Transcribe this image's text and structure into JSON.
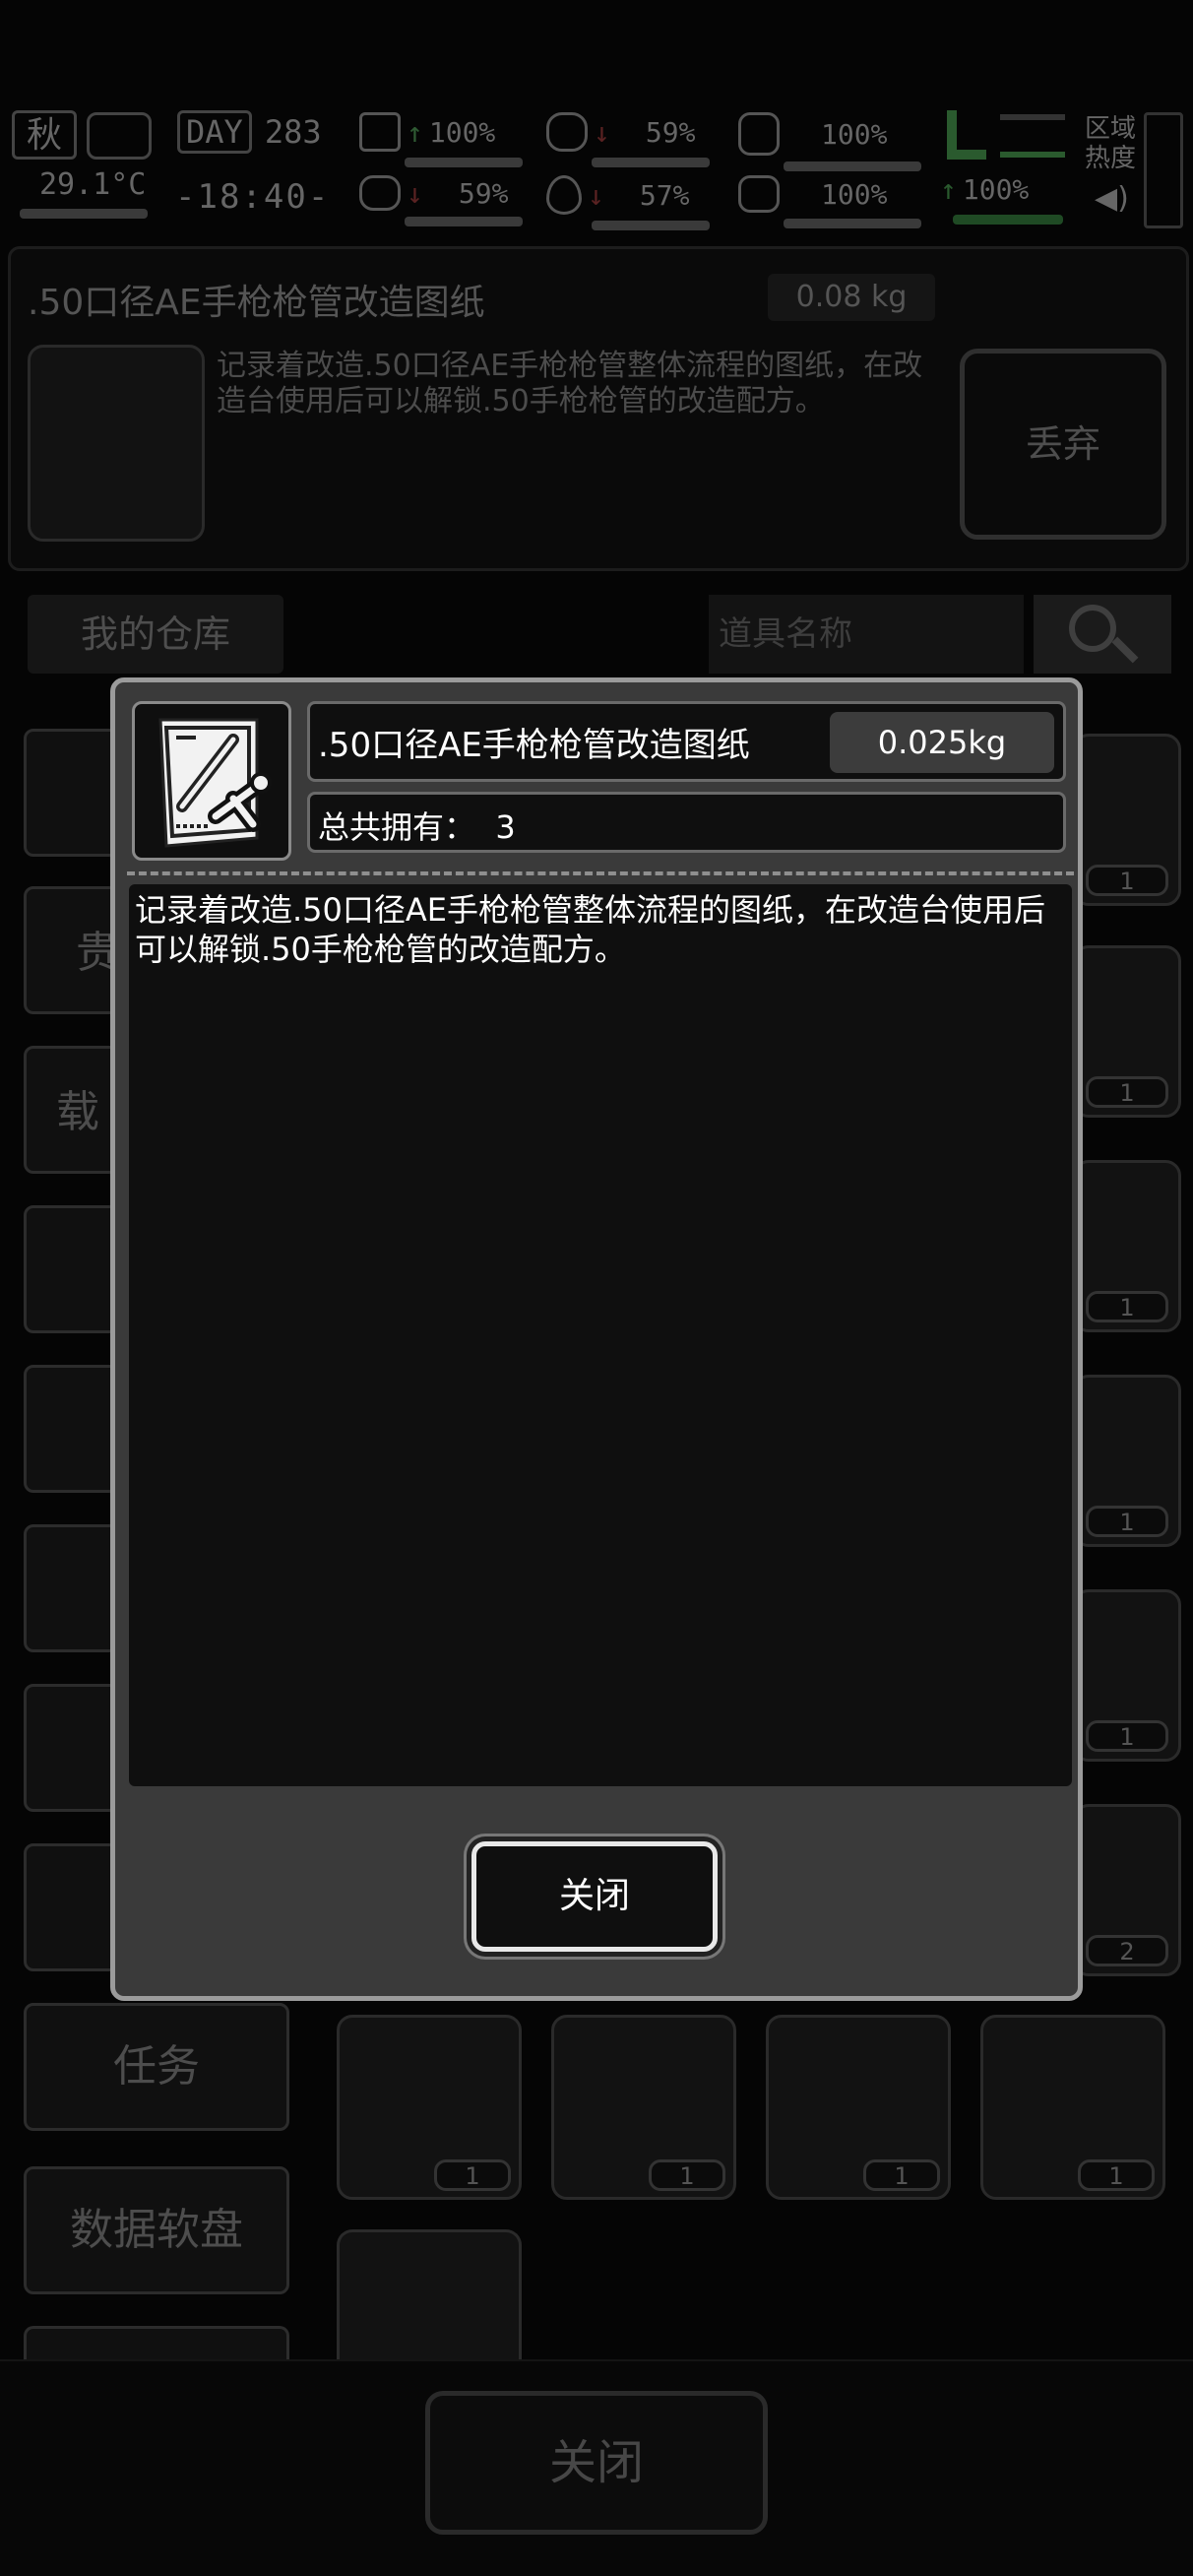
{
  "status": {
    "season": "秋",
    "day_label": "DAY",
    "day": "283",
    "temperature": "29.1°C",
    "time": "-18:40-",
    "stats": [
      {
        "icon": "medkit-icon",
        "value": "100%",
        "trend": "up"
      },
      {
        "icon": "stomach-icon",
        "value": "59%",
        "trend": "down"
      },
      {
        "icon": "armor-icon",
        "value": "100%",
        "trend": "none"
      },
      {
        "icon": "brain-icon",
        "value": "59%",
        "trend": "down"
      },
      {
        "icon": "water-drop-icon",
        "value": "57%",
        "trend": "down"
      },
      {
        "icon": "heart-icon",
        "value": "100%",
        "trend": "none"
      }
    ],
    "stamina": "100%",
    "zone_label": "区域\n热度"
  },
  "background": {
    "item_title": ".50口径AE手枪枪管改造图纸",
    "item_weight": "0.08 kg",
    "item_desc": "记录着改造.50口径AE手枪枪管整体流程的图纸，在改造台使用后可以解锁.50手枪枪管的改造配方。",
    "discard_label": "丢弃",
    "warehouse_label": "我的仓库",
    "search_placeholder": "道具名称",
    "side_tabs": [
      "",
      "贵",
      "载",
      "",
      "",
      "",
      "",
      "",
      "任务",
      "数据软盘"
    ],
    "right_counts": [
      "1",
      "1",
      "1",
      "1",
      "1",
      "2"
    ],
    "bottom_counts": [
      "1",
      "1",
      "1",
      "1"
    ],
    "close_label": "关闭"
  },
  "dialog": {
    "title": ".50口径AE手枪枪管改造图纸",
    "weight": "0.025kg",
    "owned": "总共拥有：  3",
    "description": "记录着改造.50口径AE手枪枪管整体流程的图纸，在改造台使用后可以解锁.50手枪枪管的改造配方。",
    "close_label": "关闭"
  },
  "colors": {
    "dialog_bg": "#3a3a3a",
    "dialog_border": "#9b9b9b",
    "accent_green": "#2f9a3a",
    "accent_red": "#b02a2a"
  }
}
